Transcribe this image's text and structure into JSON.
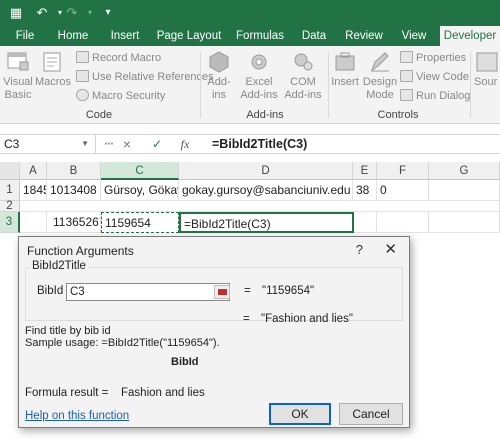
{
  "ribbon_tabs": [
    "File",
    "Home",
    "Insert",
    "Page Layout",
    "Formulas",
    "Data",
    "Review",
    "View",
    "Developer"
  ],
  "active_tab": "Developer",
  "code_group": {
    "visual_basic": "Visual\nBasic",
    "macros": "Macros",
    "record_macro": "Record Macro",
    "use_relative": "Use Relative References",
    "macro_security": "Macro Security",
    "label": "Code"
  },
  "addins_group": {
    "addins": "Add-\nins",
    "excel_addins": "Excel\nAdd-ins",
    "com_addins": "COM\nAdd-ins",
    "label": "Add-ins"
  },
  "controls_group": {
    "insert": "Insert",
    "design_mode": "Design\nMode",
    "properties": "Properties",
    "view_code": "View Code",
    "run_dialog": "Run Dialog",
    "label": "Controls"
  },
  "source_label": "Sour",
  "name_box": "C3",
  "formula_bar": {
    "cancel_icon": "×",
    "enter_icon": "✓",
    "fx_icon": "fx",
    "formula": "=BibId2Title(C3)"
  },
  "columns": [
    "A",
    "B",
    "C",
    "D",
    "E",
    "F",
    "G"
  ],
  "rows": [
    "1",
    "2",
    "3"
  ],
  "cells": {
    "A1": "1845",
    "B1": "1013408",
    "C1": "Gürsoy, Gökay",
    "D1": "gokay.gursoy@sabanciuniv.edu",
    "E1": "38",
    "F1": "0",
    "B3": "1136526",
    "C3": "1159654",
    "D3": "=BibId2Title(C3)"
  },
  "dialog": {
    "title": "Function Arguments",
    "help_glyph": "?",
    "close_glyph": "✕",
    "function_name": "BibId2Title",
    "arg_label": "BibId",
    "arg_value": "C3",
    "arg_result": "\"1159654\"",
    "function_result": "\"Fashion and lies\"",
    "description": "Find title by bib id",
    "sample_usage": "Sample usage: =BibId2Title(\"1159654\").",
    "arg_name_bold": "BibId",
    "formula_result_label": "Formula result =",
    "formula_result_value": "Fashion and lies",
    "help_link": "Help on this function",
    "ok_label": "OK",
    "cancel_label": "Cancel"
  },
  "colors": {
    "excel_green": "#217346",
    "ribbon_bg": "#f3f3f3",
    "link_blue": "#1a5fb4"
  }
}
